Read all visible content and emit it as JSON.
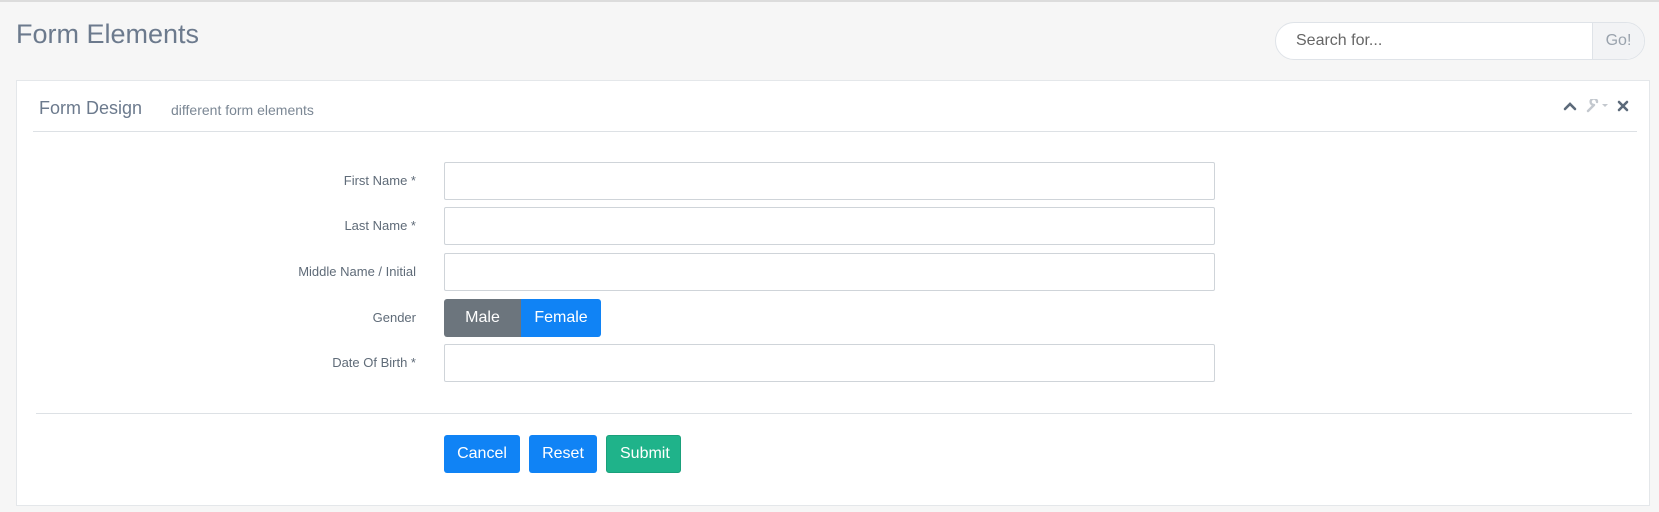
{
  "page": {
    "title": "Form Elements"
  },
  "search": {
    "placeholder": "Search for...",
    "go_label": "Go!"
  },
  "panel": {
    "title": "Form Design",
    "subtitle": "different form elements",
    "tools": [
      "chevron-up-icon",
      "wrench-icon",
      "caret-down-icon",
      "close-icon"
    ]
  },
  "form": {
    "first_name_label": "First Name *",
    "last_name_label": "Last Name *",
    "middle_name_label": "Middle Name / Initial",
    "gender_label": "Gender",
    "gender_options": {
      "male": "Male",
      "female": "Female"
    },
    "dob_label": "Date Of Birth *"
  },
  "actions": {
    "cancel": "Cancel",
    "reset": "Reset",
    "submit": "Submit"
  },
  "colors": {
    "primary": "#1083f5",
    "secondary": "#6c757d",
    "success": "#1fb38a",
    "title_text": "#6c7a8d"
  }
}
